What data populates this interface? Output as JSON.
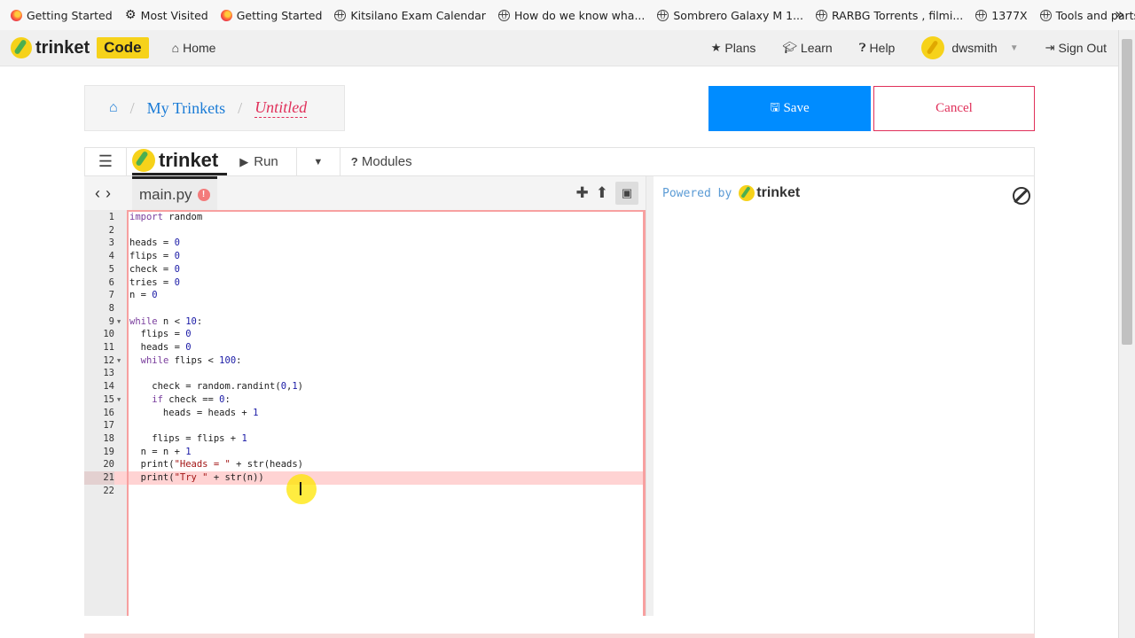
{
  "bookmarks": [
    {
      "label": "Getting Started",
      "icon": "firefox-icon"
    },
    {
      "label": "Most Visited",
      "icon": "gear-icon"
    },
    {
      "label": "Getting Started",
      "icon": "firefox-icon"
    },
    {
      "label": "Kitsilano Exam Calendar",
      "icon": "globe-icon"
    },
    {
      "label": "How do we know wha...",
      "icon": "globe-icon"
    },
    {
      "label": "Sombrero Galaxy M 1...",
      "icon": "globe-icon"
    },
    {
      "label": "RARBG Torrents , filmi...",
      "icon": "globe-icon"
    },
    {
      "label": "1377X",
      "icon": "globe-icon"
    },
    {
      "label": "Tools and parts list for...",
      "icon": "globe-icon"
    }
  ],
  "nav": {
    "logo": "trinket",
    "badge": "Code",
    "home": "Home",
    "plans": "Plans",
    "learn": "Learn",
    "help": "Help",
    "user": "dwsmith",
    "signout": "Sign Out"
  },
  "breadcrumb": {
    "my_trinkets": "My Trinkets",
    "current": "Untitled"
  },
  "actions": {
    "save": "Save",
    "cancel": "Cancel"
  },
  "toolbar": {
    "logo": "trinket",
    "run": "Run",
    "modules": "Modules"
  },
  "editor": {
    "filename": "main.py",
    "active_line": 21,
    "lines": [
      "import random",
      "",
      "heads = 0",
      "flips = 0",
      "check = 0",
      "tries = 0",
      "n = 0",
      "",
      "while n < 10:",
      "  flips = 0",
      "  heads = 0",
      "  while flips < 100:",
      "",
      "    check = random.randint(0,1)",
      "    if check == 0:",
      "      heads = heads + 1",
      "",
      "    flips = flips + 1",
      "  n = n + 1",
      "  print(\"Heads = \" + str(heads)",
      "  print(\"Try \" + str(n))",
      ""
    ]
  },
  "output": {
    "powered_by": "Powered by",
    "logo": "trinket"
  },
  "colors": {
    "accent": "#008cff",
    "danger": "#e0305a",
    "brand_yellow": "#f6d21a"
  }
}
